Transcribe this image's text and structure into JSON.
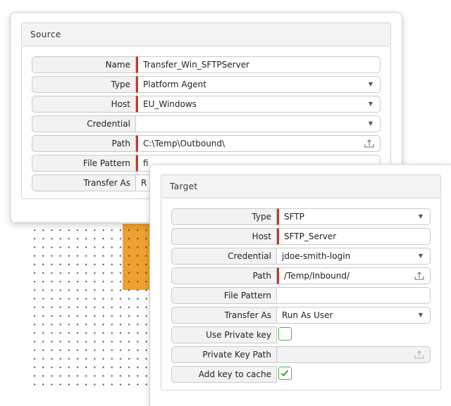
{
  "source": {
    "title": "Source",
    "fields": {
      "name": {
        "label": "Name",
        "value": "Transfer_Win_SFTPServer"
      },
      "type": {
        "label": "Type",
        "value": "Platform Agent"
      },
      "host": {
        "label": "Host",
        "value": "EU_Windows"
      },
      "credential": {
        "label": "Credential",
        "value": ""
      },
      "path": {
        "label": "Path",
        "value": "C:\\Temp\\Outbound\\"
      },
      "file_pattern": {
        "label": "File Pattern",
        "value": "fi"
      },
      "transfer_as": {
        "label": "Transfer As",
        "value": "R"
      }
    }
  },
  "target": {
    "title": "Target",
    "fields": {
      "type": {
        "label": "Type",
        "value": "SFTP"
      },
      "host": {
        "label": "Host",
        "value": "SFTP_Server"
      },
      "credential": {
        "label": "Credential",
        "value": "jdoe-smith-login"
      },
      "path": {
        "label": "Path",
        "value": "/Temp/Inbound/"
      },
      "file_pattern": {
        "label": "File Pattern",
        "value": ""
      },
      "transfer_as": {
        "label": "Transfer As",
        "value": "Run As User"
      },
      "use_private_key": {
        "label": "Use Private key",
        "checked": false
      },
      "private_key_path": {
        "label": "Private Key Path",
        "value": ""
      },
      "add_key_to_cache": {
        "label": "Add key to cache",
        "checked": true
      }
    }
  },
  "colors": {
    "required_marker": "#c0392b",
    "checkbox_border": "#4caf50",
    "accent_orange": "#f0a030"
  },
  "icons": {
    "dropdown": "caret-down-icon",
    "upload": "upload-icon",
    "check": "checkmark-icon"
  }
}
